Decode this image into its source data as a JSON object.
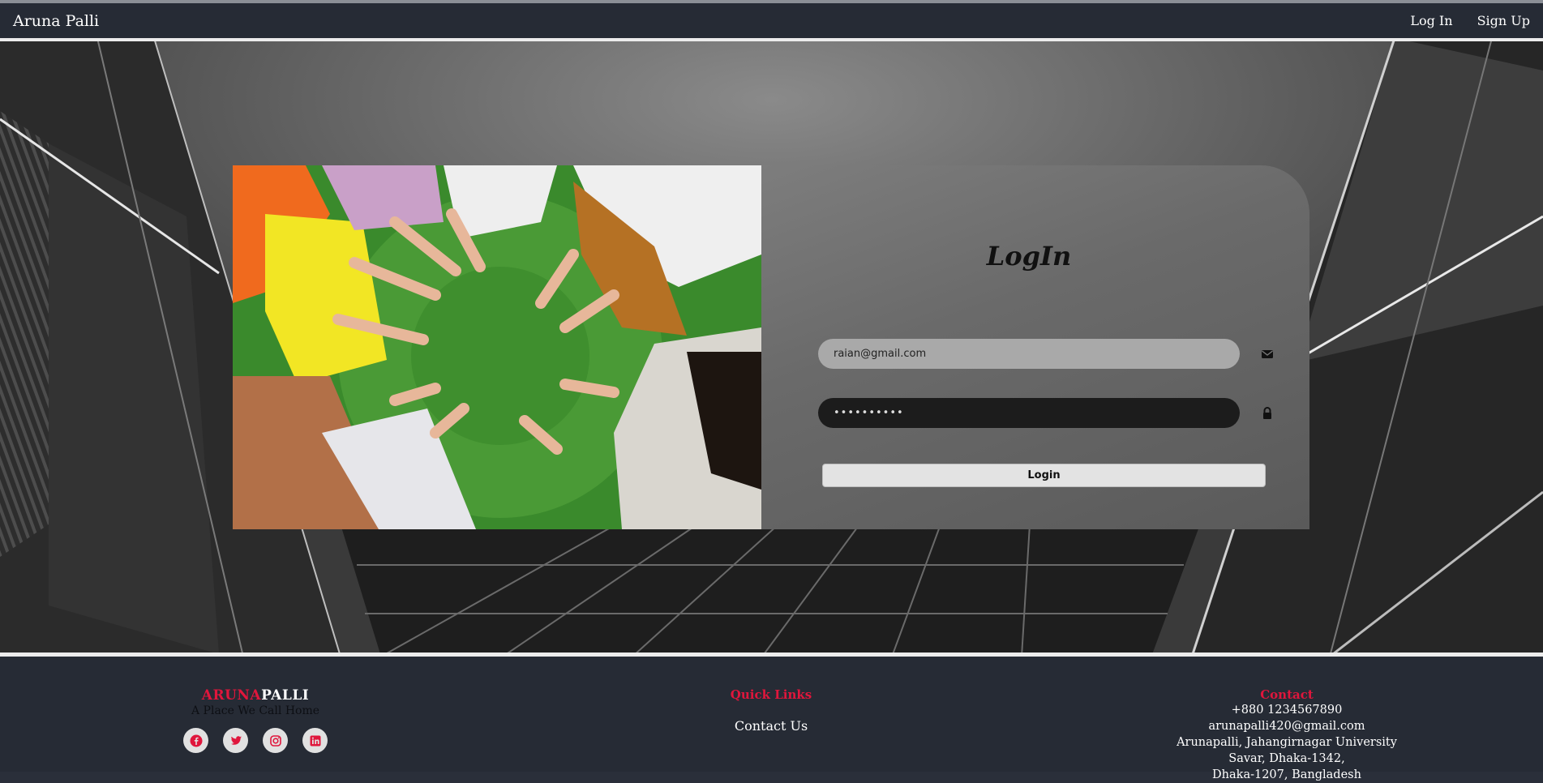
{
  "navbar": {
    "brand": "Aruna Palli",
    "links": [
      "Log In",
      "Sign Up"
    ]
  },
  "login": {
    "title": "LogIn",
    "email_value": "raian@gmail.com",
    "password_value": "••••••••••",
    "submit_label": "Login"
  },
  "footer": {
    "brand_red": "ARUNA",
    "brand_white": "PALLI",
    "tagline": "A Place We Call Home",
    "socials": [
      "facebook-icon",
      "twitter-icon",
      "instagram-icon",
      "linkedin-icon"
    ],
    "quick_links_heading": "Quick Links",
    "quick_links": [
      "Contact Us"
    ],
    "contact_heading": "Contact",
    "contact_lines": [
      "+880 1234567890",
      "arunapalli420@gmail.com",
      "Arunapalli, Jahangirnagar University",
      "Savar, Dhaka-1342,",
      "Dhaka-1207, Bangladesh"
    ]
  },
  "colors": {
    "accent_red": "#e0163c",
    "navbar_bg": "#262b35"
  }
}
